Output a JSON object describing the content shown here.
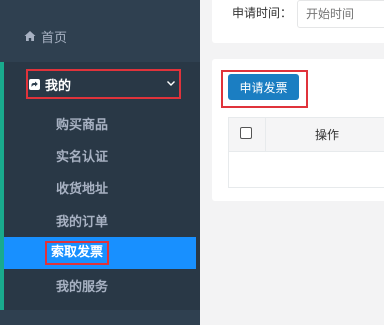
{
  "sidebar": {
    "home": {
      "label": "首页",
      "icon": "home-icon"
    },
    "my": {
      "label": "我的",
      "icon": "share-square-icon",
      "expanded": true
    },
    "sub_items": [
      {
        "label": "购买商品",
        "active": false
      },
      {
        "label": "实名认证",
        "active": false
      },
      {
        "label": "收货地址",
        "active": false
      },
      {
        "label": "我的订单",
        "active": false
      },
      {
        "label": "索取发票",
        "active": true
      },
      {
        "label": "我的服务",
        "active": false
      }
    ]
  },
  "filter": {
    "date_label": "申请时间：",
    "start_placeholder": "开始时间"
  },
  "toolbar": {
    "apply_label": "申请发票"
  },
  "table": {
    "columns": [
      "操作"
    ],
    "rows": []
  },
  "colors": {
    "sidebar_bg": "#2f4050",
    "submenu_bg": "#293846",
    "active_bg": "#1890ff",
    "button_bg": "#1b7ec2",
    "highlight_border": "#e0333b"
  }
}
